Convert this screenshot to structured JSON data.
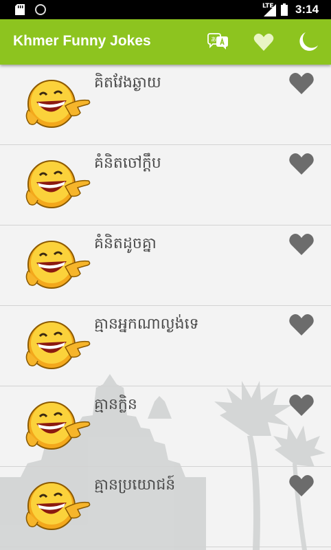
{
  "status_bar": {
    "network": "LTE",
    "time": "3:14"
  },
  "app_bar": {
    "title": "Khmer Funny Jokes",
    "icons": [
      "translate-icon",
      "heart-icon",
      "moon-icon"
    ],
    "color": "#8dc41f"
  },
  "jokes": [
    {
      "title": "គិតវែងឆ្ងាយ"
    },
    {
      "title": "គំនិតចៅក្តឹប"
    },
    {
      "title": "គំនិតដូចគ្នា"
    },
    {
      "title": "គ្មានអ្នកណាល្ងង់ទេ"
    },
    {
      "title": "គ្មានក្លិន"
    },
    {
      "title": "គ្មានប្រយោជន៍"
    }
  ]
}
